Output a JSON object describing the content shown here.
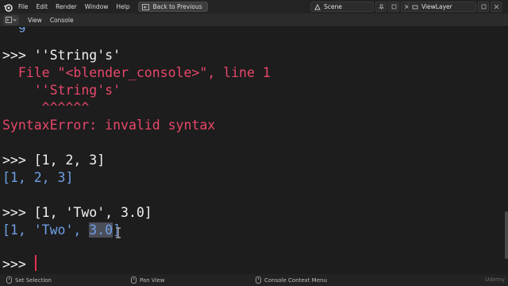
{
  "menubar": {
    "items": [
      "File",
      "Edit",
      "Render",
      "Window",
      "Help"
    ],
    "back_button": "Back to Previous",
    "scene": "Scene",
    "view_layer": "ViewLayer"
  },
  "editor_header": {
    "menus": [
      "View",
      "Console"
    ]
  },
  "console": {
    "line_partial": "  g",
    "line1": ">>> ''String's'",
    "line2": "  File \"<blender_console>\", line 1",
    "line3": "    ''String's'",
    "line4": "     ^^^^^^",
    "line5": "SyntaxError: invalid syntax",
    "line6": ">>> [1, 2, 3]",
    "line7": "[1, 2, 3]",
    "line8": ">>> [1, 'Two', 3.0]",
    "line9_pre": "[1, 'Two', ",
    "line9_sel": "3.0",
    "line9_post": "]",
    "prompt": ">>> "
  },
  "statusbar": {
    "items": [
      "Set Selection",
      "Pan View",
      "Console Context Menu"
    ],
    "watermark": "Udemy"
  },
  "colors": {
    "error": "#e8476a",
    "output": "#6f9fe6",
    "input": "#f2f2f2",
    "background": "#1d1d1d"
  }
}
